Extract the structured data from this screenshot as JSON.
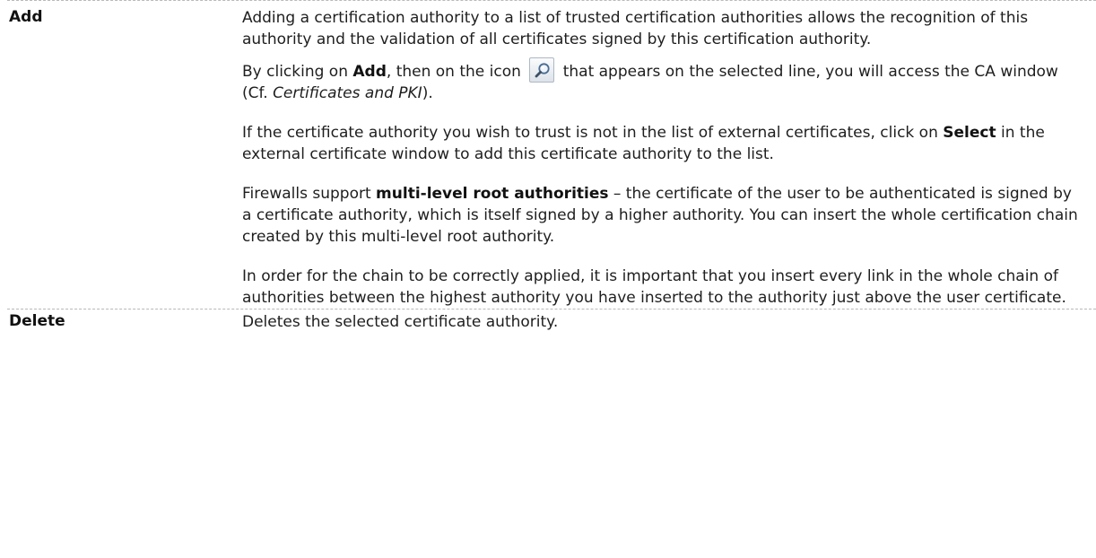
{
  "rows": [
    {
      "term": "Add",
      "paragraphs": {
        "p1": "Adding a certification authority to a list of trusted certification authorities allows the recognition of this authority and the validation of all certificates signed by this certification authority.",
        "p2_before_add": "By clicking on ",
        "p2_add": "Add",
        "p2_before_icon": ", then on the icon ",
        "p2_after_icon": " that appears on the selected line, you will access the CA window (Cf. ",
        "p2_ref": "Certificates and PKI",
        "p2_end": ").",
        "p3_before": "If the certificate authority you wish to trust is not in the list of external certificates, click on ",
        "p3_select": "Select",
        "p3_after": " in the external certificate window to add this certificate authority to the list.",
        "p4_before": "Firewalls support ",
        "p4_bold": "multi-level root authorities",
        "p4_after": " – the certificate of the user to be authenticated is signed by a certificate authority, which is itself signed by a higher authority. You can insert the whole certification chain created by this multi-level root authority.",
        "p5": "In order for the chain to be correctly applied, it is important that you insert every link in the whole chain of authorities between the highest authority you have inserted to the authority just above the user certificate."
      },
      "icon": "magnifier-icon"
    },
    {
      "term": "Delete",
      "description": "Deletes the selected certificate authority."
    }
  ],
  "colors": {
    "text": "#1e1e1e",
    "divider": "#b9b9b9"
  }
}
